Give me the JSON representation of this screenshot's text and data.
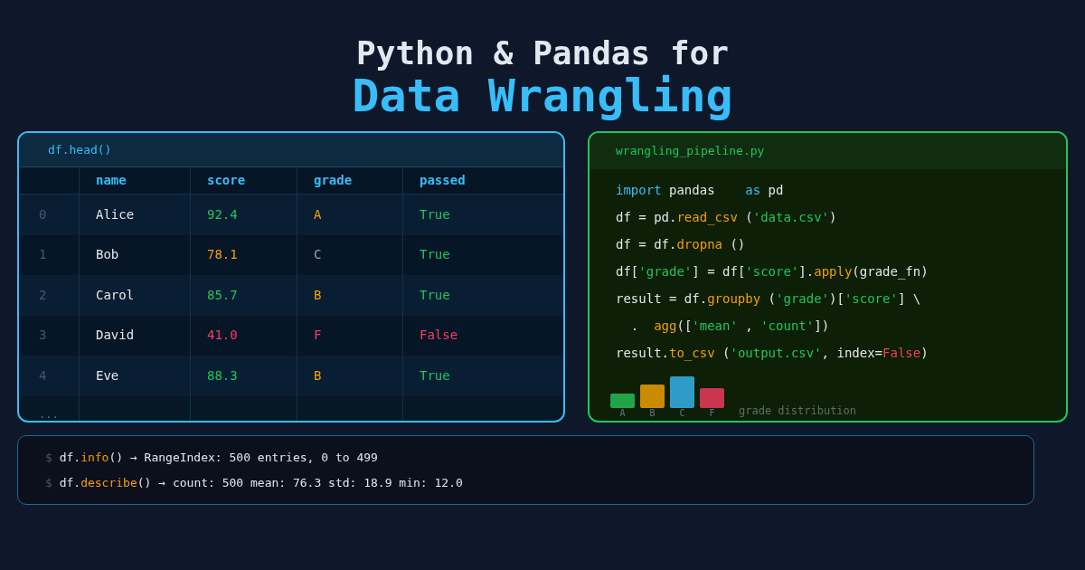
{
  "title": {
    "line1": "Python & Pandas for",
    "line2": "Data Wrangling"
  },
  "table": {
    "caption": "df.head()",
    "columns": [
      "name",
      "score",
      "grade",
      "passed"
    ],
    "rows": [
      {
        "index": "0",
        "cells": [
          {
            "kind": "plain",
            "text": "Alice"
          },
          {
            "kind": "good",
            "text": "92.4"
          },
          {
            "kind": "warn",
            "text": "A"
          },
          {
            "kind": "good",
            "text": "True"
          }
        ]
      },
      {
        "index": "1",
        "cells": [
          {
            "kind": "plain",
            "text": "Bob"
          },
          {
            "kind": "warn",
            "text": "78.1"
          },
          {
            "kind": "muted",
            "text": "C"
          },
          {
            "kind": "good",
            "text": "True"
          }
        ]
      },
      {
        "index": "2",
        "cells": [
          {
            "kind": "plain",
            "text": "Carol"
          },
          {
            "kind": "good",
            "text": "85.7"
          },
          {
            "kind": "warn",
            "text": "B"
          },
          {
            "kind": "good",
            "text": "True"
          }
        ]
      },
      {
        "index": "3",
        "cells": [
          {
            "kind": "plain",
            "text": "David"
          },
          {
            "kind": "bad",
            "text": "41.0"
          },
          {
            "kind": "bad",
            "text": "F"
          },
          {
            "kind": "bad",
            "text": "False"
          }
        ]
      },
      {
        "index": "4",
        "cells": [
          {
            "kind": "plain",
            "text": "Eve"
          },
          {
            "kind": "good",
            "text": "88.3"
          },
          {
            "kind": "warn",
            "text": "B"
          },
          {
            "kind": "good",
            "text": "True"
          }
        ]
      }
    ],
    "more": "..."
  },
  "editor": {
    "filename": "wrangling_pipeline.py",
    "lines": [
      [
        {
          "kind": "keyword",
          "text": "import"
        },
        {
          "kind": "plain",
          "text": " pandas    "
        },
        {
          "kind": "keyword",
          "text": "as"
        },
        {
          "kind": "plain",
          "text": " pd"
        }
      ],
      [
        {
          "kind": "plain",
          "text": "df = pd."
        },
        {
          "kind": "func",
          "text": "read_csv"
        },
        {
          "kind": "plain",
          "text": " ("
        },
        {
          "kind": "string",
          "text": "'data.csv'"
        },
        {
          "kind": "plain",
          "text": ")"
        }
      ],
      [
        {
          "kind": "plain",
          "text": "df = df."
        },
        {
          "kind": "func",
          "text": "dropna"
        },
        {
          "kind": "plain",
          "text": " ()"
        }
      ],
      [
        {
          "kind": "plain",
          "text": "df["
        },
        {
          "kind": "string",
          "text": "'grade'"
        },
        {
          "kind": "plain",
          "text": "] = df["
        },
        {
          "kind": "string",
          "text": "'score'"
        },
        {
          "kind": "plain",
          "text": "]."
        },
        {
          "kind": "func",
          "text": "apply"
        },
        {
          "kind": "plain",
          "text": "(grade_fn)"
        }
      ],
      [
        {
          "kind": "plain",
          "text": "result = df."
        },
        {
          "kind": "func",
          "text": "groupby"
        },
        {
          "kind": "plain",
          "text": " ("
        },
        {
          "kind": "string",
          "text": "'grade'"
        },
        {
          "kind": "plain",
          "text": ")["
        },
        {
          "kind": "string",
          "text": "'score'"
        },
        {
          "kind": "plain",
          "text": "] \\"
        }
      ],
      [
        {
          "kind": "plain",
          "text": "  .  "
        },
        {
          "kind": "func",
          "text": "agg"
        },
        {
          "kind": "plain",
          "text": "(["
        },
        {
          "kind": "string",
          "text": "'mean'"
        },
        {
          "kind": "plain",
          "text": " , "
        },
        {
          "kind": "string",
          "text": "'count'"
        },
        {
          "kind": "plain",
          "text": "])"
        }
      ],
      [
        {
          "kind": "plain",
          "text": "result."
        },
        {
          "kind": "func",
          "text": "to_csv"
        },
        {
          "kind": "plain",
          "text": " ("
        },
        {
          "kind": "string",
          "text": "'output.csv'"
        },
        {
          "kind": "plain",
          "text": ", index="
        },
        {
          "kind": "bool",
          "text": "False"
        },
        {
          "kind": "plain",
          "text": ")"
        }
      ]
    ],
    "mini_chart": {
      "caption": "grade distribution",
      "bars": [
        {
          "label": "A",
          "color": "#22a34a"
        },
        {
          "label": "B",
          "color": "#ca8a04"
        },
        {
          "label": "C",
          "color": "#2f9cc8"
        },
        {
          "label": "F",
          "color": "#c9364e"
        }
      ]
    }
  },
  "console": {
    "lines": [
      [
        {
          "kind": "prompt",
          "text": "$"
        },
        {
          "kind": "plain",
          "text": " df."
        },
        {
          "kind": "func",
          "text": "info"
        },
        {
          "kind": "plain",
          "text": "() → RangeIndex: 500 entries, 0 to 499"
        }
      ],
      [
        {
          "kind": "prompt",
          "text": "$"
        },
        {
          "kind": "plain",
          "text": " df."
        },
        {
          "kind": "func",
          "text": "describe"
        },
        {
          "kind": "plain",
          "text": "() → count: 500 mean: 76.3 std: 18.9 min: 12.0"
        }
      ]
    ]
  }
}
